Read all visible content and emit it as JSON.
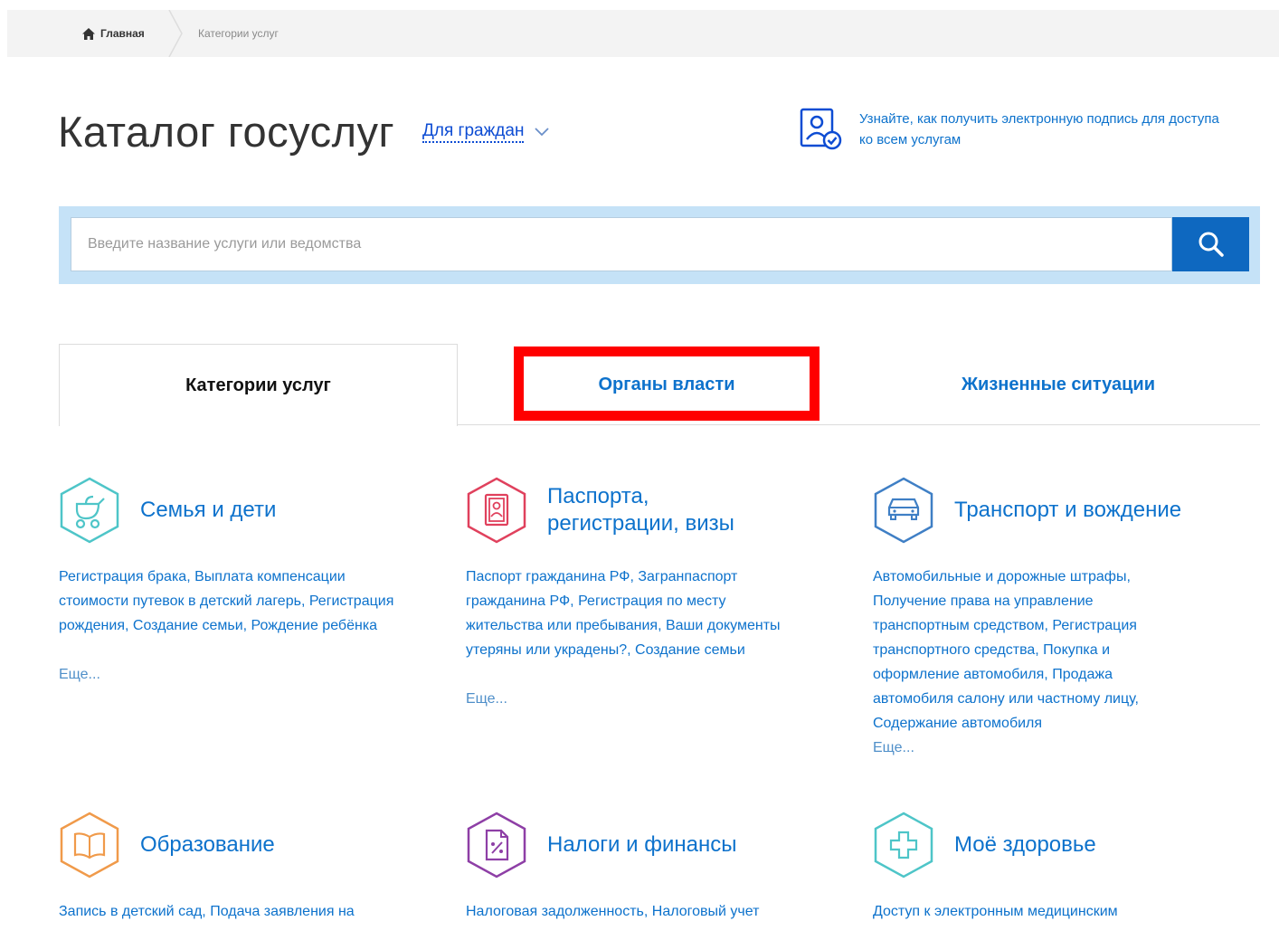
{
  "breadcrumb": {
    "home": "Главная",
    "current": "Категории услуг"
  },
  "header": {
    "title": "Каталог госуслуг",
    "audience": "Для граждан"
  },
  "signature": {
    "text": "Узнайте, как получить электронную подпись для доступа ко всем услугам"
  },
  "search": {
    "placeholder": "Введите название услуги или ведомства"
  },
  "tabs": [
    {
      "label": "Категории услуг"
    },
    {
      "label": "Органы власти"
    },
    {
      "label": "Жизненные ситуации"
    }
  ],
  "categories": [
    {
      "name": "Семья и дети",
      "desc": "Регистрация брака, Выплата компенсации стоимости путевок в детский лагерь, Регистрация рождения, Создание семьи, Рождение ребёнка",
      "more": "Еще...",
      "icon": "stroller-icon",
      "color": "#4ec5c8"
    },
    {
      "name": "Паспорта, регистрации, визы",
      "desc": "Паспорт гражданина РФ, Загранпаспорт гражданина РФ, Регистрация по месту жительства или пребывания, Ваши документы утеряны или украдены?, Создание семьи",
      "more": "Еще...",
      "icon": "passport-icon",
      "color": "#e0415d"
    },
    {
      "name": "Транспорт и вождение",
      "desc": "Автомобильные и дорожные штрафы, Получение права на управление транспортным средством, Регистрация транспортного средства, Покупка и оформление автомобиля, Продажа автомобиля салону или частному лицу, Содержание автомобиля",
      "more": "Еще...",
      "icon": "car-icon",
      "color": "#3f7fc5"
    },
    {
      "name": "Образование",
      "desc": "Запись в детский сад, Подача заявления на",
      "icon": "book-icon",
      "color": "#f09a4a"
    },
    {
      "name": "Налоги и финансы",
      "desc": "Налоговая задолженность, Налоговый учет",
      "icon": "tax-document-icon",
      "color": "#8e3fa6"
    },
    {
      "name": "Моё здоровье",
      "desc": "Доступ к электронным медицинским",
      "icon": "medical-cross-icon",
      "color": "#4ec5c8"
    }
  ]
}
